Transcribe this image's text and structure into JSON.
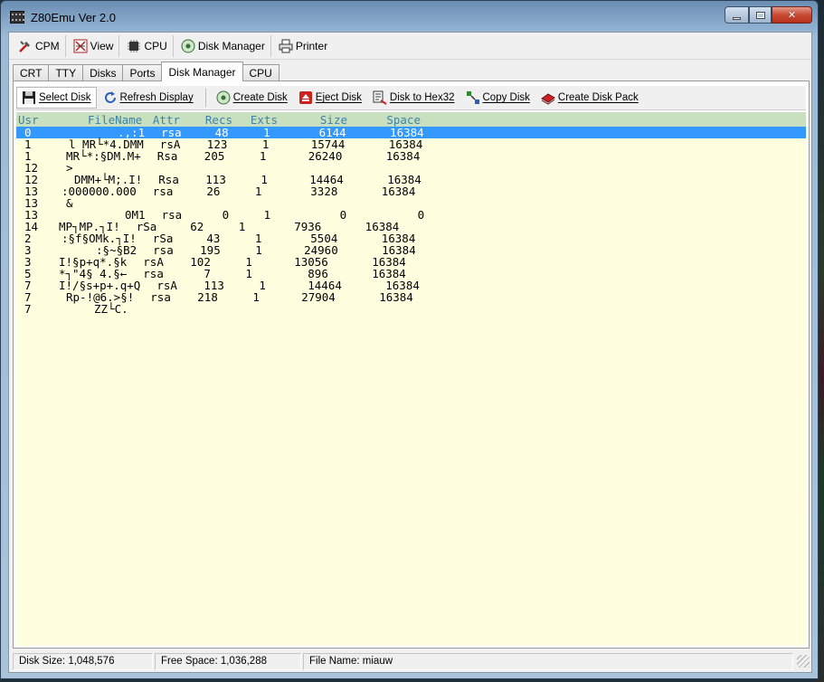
{
  "window": {
    "title": "Z80Emu Ver 2.0"
  },
  "toolbar": [
    {
      "label": "CPM",
      "icon": "tools-icon"
    },
    {
      "label": "View",
      "icon": "view-icon"
    },
    {
      "label": "CPU",
      "icon": "cpu-icon"
    },
    {
      "label": "Disk Manager",
      "icon": "disk-icon"
    },
    {
      "label": "Printer",
      "icon": "printer-icon"
    }
  ],
  "tabs": [
    {
      "label": "CRT",
      "active": false
    },
    {
      "label": "TTY",
      "active": false
    },
    {
      "label": "Disks",
      "active": false
    },
    {
      "label": "Ports",
      "active": false
    },
    {
      "label": "Disk Manager",
      "active": true
    },
    {
      "label": "CPU",
      "active": false
    }
  ],
  "disk_toolbar": [
    {
      "label": "Select Disk",
      "icon": "floppy-icon"
    },
    {
      "label": "Refresh Display",
      "icon": "refresh-icon"
    },
    {
      "label": "Create Disk",
      "icon": "create-disk-icon"
    },
    {
      "label": "Eject Disk",
      "icon": "eject-icon"
    },
    {
      "label": "Disk to Hex32",
      "icon": "hex-icon"
    },
    {
      "label": "Copy Disk",
      "icon": "copy-icon"
    },
    {
      "label": "Create Disk Pack",
      "icon": "disk-pack-icon"
    }
  ],
  "list": {
    "headers": [
      "Usr",
      "FileName",
      "Attr",
      "Recs",
      "Exts",
      "Size",
      "Space"
    ],
    "rows": [
      {
        "usr": "0",
        "name": ".,:1",
        "attr": "rsa",
        "recs": "48",
        "exts": "1",
        "size": "6144",
        "space": "16384"
      },
      {
        "usr": "1",
        "name": "l MR└*4.DMM",
        "attr": "rsA",
        "recs": "123",
        "exts": "1",
        "size": "15744",
        "space": "16384"
      },
      {
        "usr": "1",
        "name": "MR└*:§DM.M+",
        "attr": "Rsa",
        "recs": "205",
        "exts": "1",
        "size": "26240",
        "space": "16384"
      },
      {
        "usr": "12",
        "name": ">",
        "attr": "",
        "recs": "",
        "exts": "",
        "size": "",
        "space": ""
      },
      {
        "usr": "12",
        "name": "DMM+└M;.I!",
        "attr": "Rsa",
        "recs": "113",
        "exts": "1",
        "size": "14464",
        "space": "16384"
      },
      {
        "usr": "13",
        "name": ":000000.000",
        "attr": "rsa",
        "recs": "26",
        "exts": "1",
        "size": "3328",
        "space": "16384"
      },
      {
        "usr": "13",
        "name": "&",
        "attr": "",
        "recs": "",
        "exts": "",
        "size": "",
        "space": ""
      },
      {
        "usr": "13",
        "name": "0M1",
        "attr": "rsa",
        "recs": "0",
        "exts": "1",
        "size": "0",
        "space": "0"
      },
      {
        "usr": "14",
        "name": "MP┐MP.┐I!",
        "attr": "rSa",
        "recs": "62",
        "exts": "1",
        "size": "7936",
        "space": "16384"
      },
      {
        "usr": "2",
        "name": ":§f§OMk.┐I!",
        "attr": "rSa",
        "recs": "43",
        "exts": "1",
        "size": "5504",
        "space": "16384"
      },
      {
        "usr": "3",
        "name": ":§~§B2",
        "attr": "rsa",
        "recs": "195",
        "exts": "1",
        "size": "24960",
        "space": "16384"
      },
      {
        "usr": "3",
        "name": "I!§p+q*.§k",
        "attr": "rsA",
        "recs": "102",
        "exts": "1",
        "size": "13056",
        "space": "16384"
      },
      {
        "usr": "5",
        "name": "*┐\"4§ 4.§←",
        "attr": "rsa",
        "recs": "7",
        "exts": "1",
        "size": "896",
        "space": "16384"
      },
      {
        "usr": "7",
        "name": "I!/§s+p+.q+Q",
        "attr": "rsA",
        "recs": "113",
        "exts": "1",
        "size": "14464",
        "space": "16384"
      },
      {
        "usr": "7",
        "name": "Rp-!@6.>§!",
        "attr": "rsa",
        "recs": "218",
        "exts": "1",
        "size": "27904",
        "space": "16384"
      },
      {
        "usr": "7",
        "name": "ZZ└C.",
        "attr": "",
        "recs": "",
        "exts": "",
        "size": "",
        "space": ""
      }
    ]
  },
  "status": {
    "disk_size": "Disk Size: 1,048,576",
    "free_space": "Free Space: 1,036,288",
    "file_name": "File Name:  miauw"
  }
}
